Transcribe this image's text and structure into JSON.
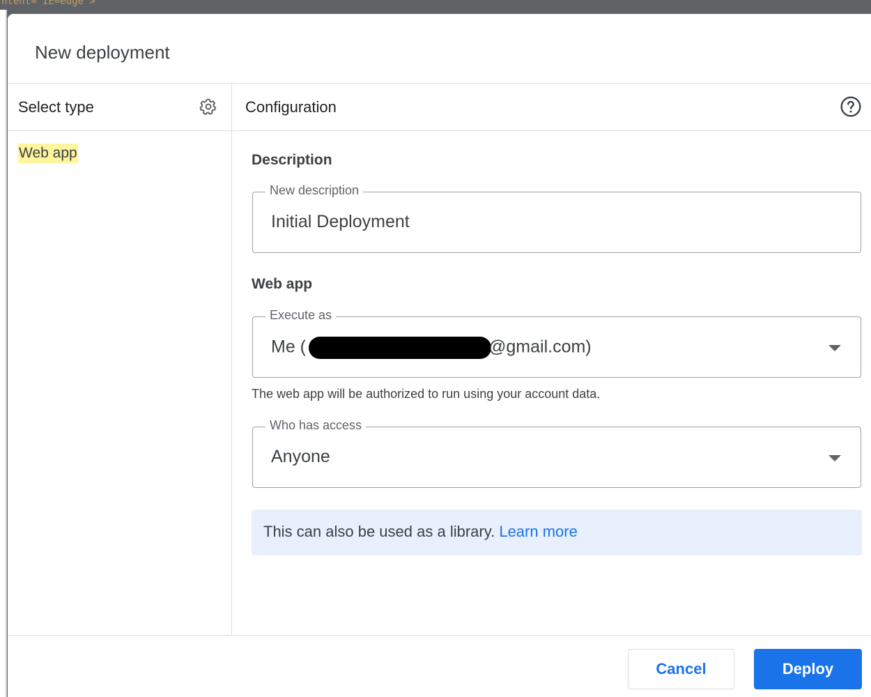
{
  "background": {
    "code_snippet": "ntent=\"IE=edge\">"
  },
  "dialog": {
    "title": "New deployment"
  },
  "left_panel": {
    "header": "Select type",
    "settings_icon": "gear-icon",
    "items": [
      {
        "label": "Web app",
        "selected": true
      }
    ]
  },
  "right_panel": {
    "header": "Configuration",
    "help_icon": "help-circle-icon",
    "description_section": {
      "title": "Description",
      "field_label": "New description",
      "field_value": "Initial Deployment"
    },
    "webapp_section": {
      "title": "Web app",
      "execute_as": {
        "label": "Execute as",
        "value_prefix": "Me (",
        "value_suffix": "@gmail.com)"
      },
      "helper_text": "The web app will be authorized to run using your account data.",
      "who_has_access": {
        "label": "Who has access",
        "value": "Anyone"
      }
    },
    "info_banner": {
      "text": "This can also be used as a library.",
      "link": "Learn more"
    }
  },
  "footer": {
    "cancel_label": "Cancel",
    "deploy_label": "Deploy"
  },
  "colors": {
    "accent": "#1a73e8",
    "highlight": "#fff59d",
    "banner_bg": "#e8f0fe"
  }
}
